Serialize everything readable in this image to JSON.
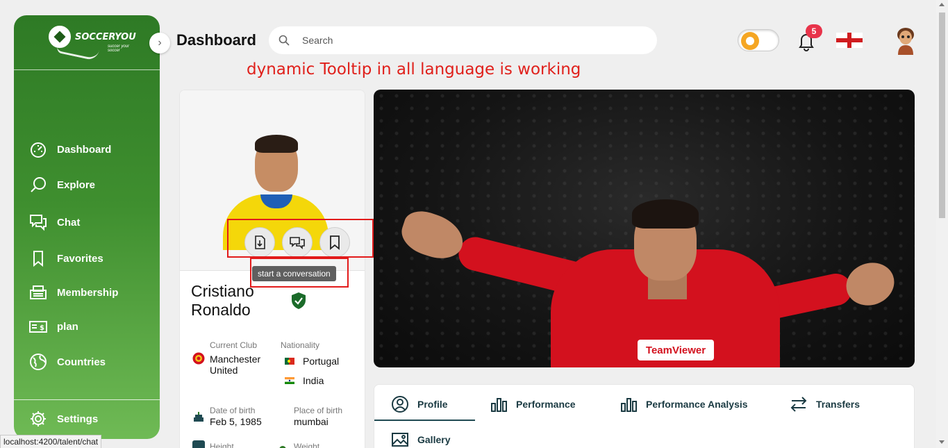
{
  "sidebar": {
    "logo_text": "SOCCERYOU",
    "logo_tagline": "succer your soccer",
    "items": [
      {
        "label": "Dashboard",
        "icon": "gauge-icon"
      },
      {
        "label": "Explore",
        "icon": "search-icon"
      },
      {
        "label": "Chat",
        "icon": "chat-icon"
      },
      {
        "label": "Favorites",
        "icon": "bookmark-icon"
      },
      {
        "label": "Membership",
        "icon": "membership-icon"
      },
      {
        "label": "plan",
        "icon": "money-icon"
      },
      {
        "label": "Countries",
        "icon": "globe-icon"
      }
    ],
    "settings_label": "Settings"
  },
  "header": {
    "title": "Dashboard",
    "search_placeholder": "Search",
    "notification_count": "5"
  },
  "annotation": "dynamic Tooltip in all language is working",
  "profile": {
    "name_first": "Cristiano",
    "name_last": "Ronaldo",
    "tooltip": "start a conversation",
    "current_club_label": "Current Club",
    "current_club_line1": "Manchester",
    "current_club_line2": "United",
    "nationality_label": "Nationality",
    "nationalities": [
      "Portugal",
      "India"
    ],
    "dob_label": "Date of birth",
    "dob": "Feb 5, 1985",
    "pob_label": "Place of birth",
    "pob": "mumbai",
    "height_label": "Height",
    "weight_label": "Weight"
  },
  "hero": {
    "sponsor": "TeamViewer"
  },
  "tabs": [
    {
      "label": "Profile",
      "icon": "user-circle-icon"
    },
    {
      "label": "Performance",
      "icon": "bar-chart-icon"
    },
    {
      "label": "Performance Analysis",
      "icon": "bar-chart-icon"
    },
    {
      "label": "Transfers",
      "icon": "transfer-arrows-icon"
    },
    {
      "label": "Gallery",
      "icon": "image-icon"
    }
  ],
  "status_bar_url": "localhost:4200/talent/chat",
  "colors": {
    "sidebar_green": "#2e7a25",
    "accent_red": "#e21b1b",
    "badge_red": "#e8334a",
    "tab_text": "#1a3a42"
  }
}
